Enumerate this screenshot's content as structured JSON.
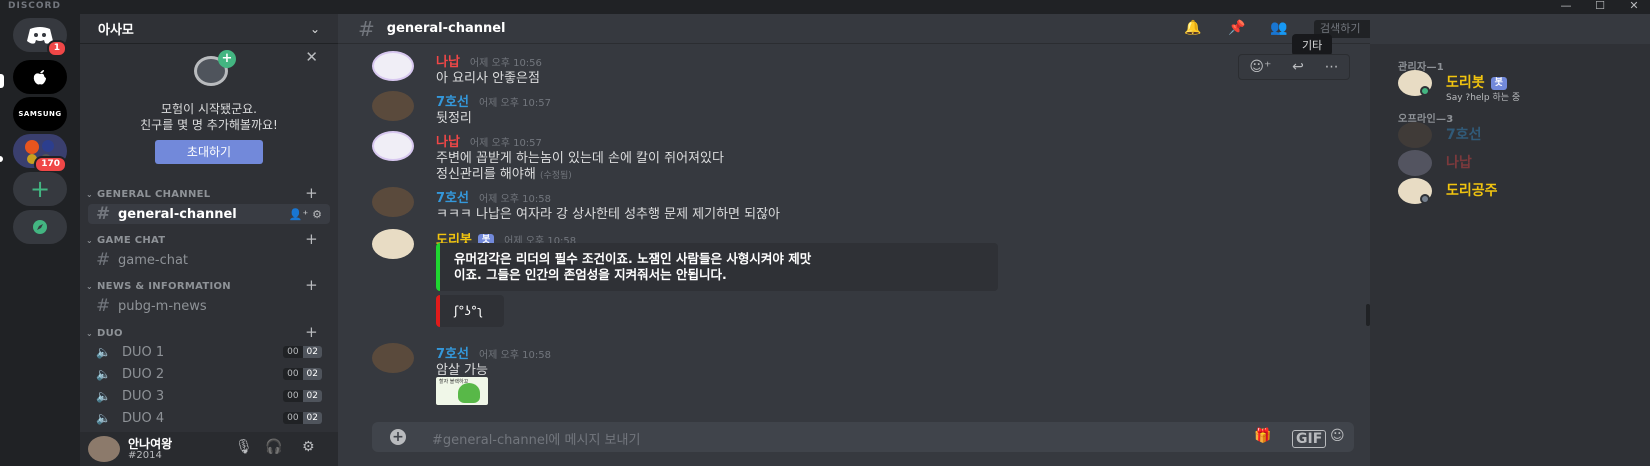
{
  "titlebar": {
    "brand": "DISCORD",
    "minimize": "—",
    "maximize": "☐",
    "close": "✕"
  },
  "servers": {
    "home_badge": "1",
    "apple": "",
    "samsung": "SAMSUNG",
    "group_badge": "170",
    "add": "+",
    "explore": "⊘"
  },
  "guild": {
    "name": "아사모",
    "chevron": "⌄"
  },
  "invite": {
    "line1": "모험이 시작됐군요.",
    "line2": "친구를 몇 명 추가해볼까요!",
    "button": "초대하기",
    "close": "✕"
  },
  "categories": {
    "general": "GENERAL CHANNEL",
    "game": "GAME CHAT",
    "news": "NEWS & INFORMATION",
    "duo": "DUO"
  },
  "channels": {
    "general": "general-channel",
    "game": "game-chat",
    "news": "pubg-m-news"
  },
  "voice": [
    {
      "name": "DUO 1",
      "a": "00",
      "b": "02"
    },
    {
      "name": "DUO 2",
      "a": "00",
      "b": "02"
    },
    {
      "name": "DUO 3",
      "a": "00",
      "b": "02"
    },
    {
      "name": "DUO 4",
      "a": "00",
      "b": "02"
    }
  ],
  "user": {
    "name": "안나여왕",
    "tag": "#2014"
  },
  "header": {
    "channel": "general-channel",
    "search_placeholder": "검색하기"
  },
  "tooltip": "기타",
  "messages": [
    {
      "author": "나납",
      "color": "#f04747",
      "time": "어제 오후 10:56",
      "lines": [
        "아 요리사 안좋은점"
      ]
    },
    {
      "author": "7호선",
      "color": "#3498db",
      "time": "어제 오후 10:57",
      "lines": [
        "뒷정리"
      ]
    },
    {
      "author": "나납",
      "color": "#f04747",
      "time": "어제 오후 10:57",
      "lines": [
        "주변에 꼽받게 하는놈이 있는데 손에 칼이 쥐어져있다",
        "정신관리를 해야해"
      ],
      "edited": "(수정됨)"
    },
    {
      "author": "7호선",
      "color": "#3498db",
      "time": "어제 오후 10:58",
      "lines": [
        "ㅋㅋㅋ 나납은 여자라 강 상사한테 성추행 문제 제기하면 되잖아"
      ]
    },
    {
      "author": "도리봇",
      "color": "#f1c40f",
      "time": "어제 오후 10:58",
      "bot": "봇",
      "embed1": [
        "유머감각은 리더의 필수 조건이죠. 노잼인 사람들은 사형시켜야 제맛",
        "이죠. 그들은 인간의 존엄성을 지켜줘서는 안됩니다."
      ],
      "embed2": "ʃ°ʖ°ʅ"
    },
    {
      "author": "7호선",
      "color": "#3498db",
      "time": "어제 오후 10:58",
      "lines": [
        "암살 가능"
      ],
      "thumb_text": "할자 블랙하꼬"
    }
  ],
  "composer": {
    "placeholder": "#general-channel에 메시지 보내기",
    "gif": "GIF"
  },
  "members": {
    "admin_header": "관리자—1",
    "offline_header": "오프라인—3",
    "admin": [
      {
        "name": "도리봇",
        "badge": "봇",
        "status": "Say ?help 하는 중",
        "color": "#f1c40f"
      }
    ],
    "offline": [
      {
        "name": "7호선",
        "color": "#3498db"
      },
      {
        "name": "나납",
        "color": "#f04747"
      },
      {
        "name": "도리공주",
        "color": "#f1c40f"
      }
    ]
  }
}
